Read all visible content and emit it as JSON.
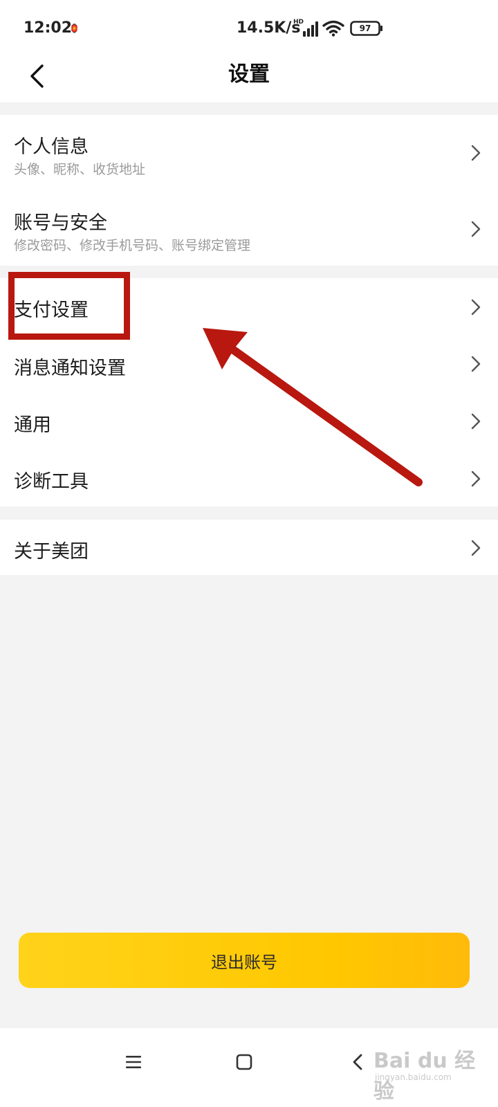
{
  "status_bar": {
    "time": "12:02",
    "notification_glyph": "🏮",
    "network_speed": "14.5K/s",
    "signal_label": "HD",
    "battery_level": "97"
  },
  "header": {
    "title": "设置",
    "back_icon": "chevron-left-icon"
  },
  "settings": {
    "group1": [
      {
        "title": "个人信息",
        "subtitle": "头像、昵称、收货地址"
      },
      {
        "title": "账号与安全",
        "subtitle": "修改密码、修改手机号码、账号绑定管理"
      }
    ],
    "group2": [
      {
        "title": "支付设置"
      },
      {
        "title": "消息通知设置"
      },
      {
        "title": "通用"
      },
      {
        "title": "诊断工具"
      }
    ],
    "group3": [
      {
        "title": "关于美团"
      }
    ]
  },
  "logout": {
    "label": "退出账号"
  },
  "annotation": {
    "color": "#b8180f"
  },
  "nav_bar": {
    "icons": [
      "menu-icon",
      "home-icon",
      "back-icon"
    ]
  },
  "watermark": {
    "logo": "Bai du 经验",
    "sub": "jingyan.baidu.com"
  },
  "colors": {
    "accent": "#ffc700",
    "background": "#f3f3f3",
    "chevron": "#555555"
  }
}
